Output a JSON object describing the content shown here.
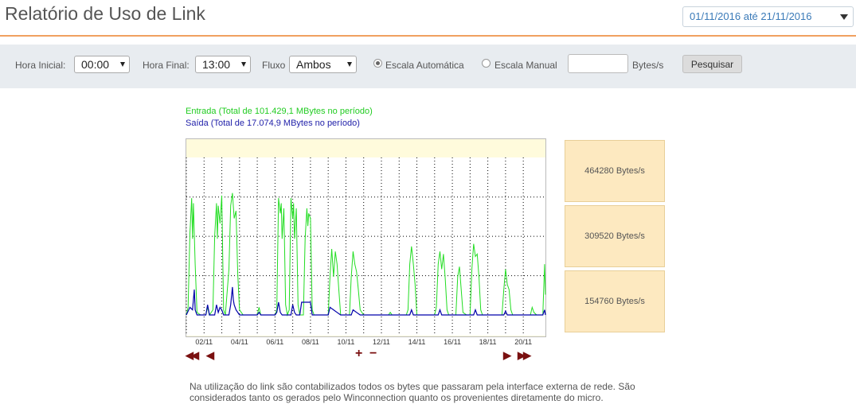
{
  "page": {
    "title": "Relatório de Uso de Link",
    "date_range": "01/11/2016 até 21/11/2016"
  },
  "filters": {
    "hora_inicial_label": "Hora Inicial:",
    "hora_inicial_value": "00:00",
    "hora_final_label": "Hora Final:",
    "hora_final_value": "13:00",
    "fluxo_label": "Fluxo",
    "fluxo_value": "Ambos",
    "escala_auto_label": "Escala Automática",
    "escala_auto_selected": true,
    "escala_manual_label": "Escala Manual",
    "bytes_value": "",
    "bytes_unit": "Bytes/s",
    "search_label": "Pesquisar"
  },
  "legend": {
    "entrada": "Entrada (Total de 101.429,1 MBytes no período)",
    "saida": "Saída (Total de 17.074,9 MBytes no período)"
  },
  "scale_labels": [
    "464280 Bytes/s",
    "309520 Bytes/s",
    "154760 Bytes/s"
  ],
  "nav": {
    "first": "◀◀",
    "prev": "◀",
    "zoom_in": "+",
    "zoom_out": "−",
    "next": "▶",
    "last": "▶▶"
  },
  "note": "Na utilização do link são contabilizados todos os bytes que passaram pela interface externa de rede. São considerados tanto os gerados pelo Winconnection quanto os provenientes diretamente do micro.",
  "chart_data": {
    "type": "line",
    "x_tick_labels": [
      "02/11",
      "04/11",
      "06/11",
      "08/11",
      "10/11",
      "12/11",
      "14/11",
      "16/11",
      "18/11",
      "20/11"
    ],
    "x_range_days": [
      1,
      21.25
    ],
    "ylim": [
      0,
      620000
    ],
    "y_gridlines": [
      154760,
      309520,
      464280
    ],
    "colors": {
      "entrada": "#22dd22",
      "saida": "#0000aa"
    },
    "series": [
      {
        "name": "Entrada",
        "points": [
          [
            1,
            0
          ],
          [
            1.1,
            30000
          ],
          [
            1.2,
            320000
          ],
          [
            1.3,
            460000
          ],
          [
            1.35,
            300000
          ],
          [
            1.4,
            440000
          ],
          [
            1.5,
            200000
          ],
          [
            1.6,
            10000
          ],
          [
            1.8,
            0
          ],
          [
            2.1,
            0
          ],
          [
            2.2,
            30000
          ],
          [
            2.3,
            0
          ],
          [
            2.5,
            20000
          ],
          [
            2.6,
            310000
          ],
          [
            2.7,
            440000
          ],
          [
            2.75,
            300000
          ],
          [
            2.8,
            430000
          ],
          [
            2.9,
            360000
          ],
          [
            3.0,
            470000
          ],
          [
            3.1,
            20000
          ],
          [
            3.2,
            0
          ],
          [
            3.4,
            180000
          ],
          [
            3.5,
            430000
          ],
          [
            3.6,
            480000
          ],
          [
            3.7,
            380000
          ],
          [
            3.8,
            410000
          ],
          [
            3.9,
            160000
          ],
          [
            4.0,
            20000
          ],
          [
            4.2,
            0
          ],
          [
            5.0,
            0
          ],
          [
            5.1,
            30000
          ],
          [
            5.2,
            0
          ],
          [
            6.0,
            0
          ],
          [
            6.1,
            20000
          ],
          [
            6.2,
            460000
          ],
          [
            6.3,
            400000
          ],
          [
            6.35,
            440000
          ],
          [
            6.4,
            300000
          ],
          [
            6.5,
            420000
          ],
          [
            6.6,
            40000
          ],
          [
            6.7,
            0
          ],
          [
            6.8,
            20000
          ],
          [
            6.9,
            460000
          ],
          [
            7.0,
            380000
          ],
          [
            7.05,
            440000
          ],
          [
            7.1,
            300000
          ],
          [
            7.2,
            420000
          ],
          [
            7.3,
            40000
          ],
          [
            7.4,
            0
          ],
          [
            7.6,
            0
          ],
          [
            7.7,
            300000
          ],
          [
            7.8,
            420000
          ],
          [
            7.85,
            350000
          ],
          [
            7.9,
            400000
          ],
          [
            8.0,
            380000
          ],
          [
            8.1,
            20000
          ],
          [
            8.2,
            0
          ],
          [
            9.0,
            0
          ],
          [
            9.1,
            150000
          ],
          [
            9.2,
            260000
          ],
          [
            9.3,
            150000
          ],
          [
            9.4,
            250000
          ],
          [
            9.5,
            200000
          ],
          [
            9.6,
            100000
          ],
          [
            9.7,
            0
          ],
          [
            10.2,
            0
          ],
          [
            10.3,
            150000
          ],
          [
            10.4,
            250000
          ],
          [
            10.5,
            200000
          ],
          [
            10.6,
            170000
          ],
          [
            10.7,
            100000
          ],
          [
            10.8,
            20000
          ],
          [
            11.0,
            0
          ],
          [
            12.4,
            0
          ],
          [
            12.5,
            10000
          ],
          [
            12.6,
            0
          ],
          [
            13.4,
            0
          ],
          [
            13.5,
            20000
          ],
          [
            13.6,
            200000
          ],
          [
            13.7,
            270000
          ],
          [
            13.8,
            200000
          ],
          [
            13.9,
            120000
          ],
          [
            14.0,
            0
          ],
          [
            15.0,
            0
          ],
          [
            15.1,
            30000
          ],
          [
            15.2,
            200000
          ],
          [
            15.3,
            250000
          ],
          [
            15.4,
            180000
          ],
          [
            15.5,
            240000
          ],
          [
            15.6,
            140000
          ],
          [
            15.7,
            20000
          ],
          [
            15.8,
            0
          ],
          [
            16.2,
            0
          ],
          [
            16.3,
            150000
          ],
          [
            16.4,
            190000
          ],
          [
            16.5,
            100000
          ],
          [
            16.6,
            10000
          ],
          [
            16.8,
            0
          ],
          [
            17.0,
            0
          ],
          [
            17.1,
            180000
          ],
          [
            17.2,
            280000
          ],
          [
            17.3,
            230000
          ],
          [
            17.4,
            240000
          ],
          [
            17.5,
            150000
          ],
          [
            17.6,
            20000
          ],
          [
            17.7,
            0
          ],
          [
            18.8,
            0
          ],
          [
            18.9,
            100000
          ],
          [
            19.0,
            180000
          ],
          [
            19.1,
            120000
          ],
          [
            19.2,
            100000
          ],
          [
            19.3,
            20000
          ],
          [
            19.4,
            0
          ],
          [
            20.4,
            0
          ],
          [
            20.5,
            30000
          ],
          [
            20.6,
            10000
          ],
          [
            20.75,
            0
          ],
          [
            21.1,
            0
          ],
          [
            21.2,
            200000
          ],
          [
            21.25,
            80000
          ]
        ]
      },
      {
        "name": "Saída",
        "points": [
          [
            1,
            0
          ],
          [
            1.2,
            30000
          ],
          [
            1.35,
            20000
          ],
          [
            1.45,
            100000
          ],
          [
            1.5,
            20000
          ],
          [
            1.6,
            0
          ],
          [
            2.1,
            0
          ],
          [
            2.2,
            40000
          ],
          [
            2.3,
            0
          ],
          [
            2.6,
            0
          ],
          [
            2.7,
            40000
          ],
          [
            2.8,
            10000
          ],
          [
            2.9,
            30000
          ],
          [
            3.0,
            20000
          ],
          [
            3.1,
            0
          ],
          [
            3.4,
            0
          ],
          [
            3.5,
            40000
          ],
          [
            3.6,
            110000
          ],
          [
            3.65,
            60000
          ],
          [
            3.7,
            40000
          ],
          [
            3.8,
            20000
          ],
          [
            4.0,
            0
          ],
          [
            4.2,
            0
          ],
          [
            5.0,
            0
          ],
          [
            5.1,
            10000
          ],
          [
            5.2,
            0
          ],
          [
            6.0,
            0
          ],
          [
            6.1,
            10000
          ],
          [
            6.2,
            50000
          ],
          [
            6.3,
            10000
          ],
          [
            6.4,
            0
          ],
          [
            6.9,
            0
          ],
          [
            7.0,
            40000
          ],
          [
            7.1,
            10000
          ],
          [
            7.2,
            0
          ],
          [
            7.4,
            0
          ],
          [
            7.5,
            50000
          ],
          [
            8.0,
            50000
          ],
          [
            8.1,
            0
          ],
          [
            9.0,
            0
          ],
          [
            9.1,
            30000
          ],
          [
            9.3,
            20000
          ],
          [
            9.5,
            10000
          ],
          [
            9.7,
            0
          ],
          [
            10.3,
            0
          ],
          [
            10.4,
            20000
          ],
          [
            10.6,
            10000
          ],
          [
            10.8,
            0
          ],
          [
            13.6,
            0
          ],
          [
            13.7,
            20000
          ],
          [
            13.8,
            0
          ],
          [
            15.2,
            0
          ],
          [
            15.3,
            20000
          ],
          [
            15.4,
            0
          ],
          [
            17.2,
            0
          ],
          [
            17.3,
            20000
          ],
          [
            17.4,
            0
          ],
          [
            18.9,
            0
          ],
          [
            19.0,
            15000
          ],
          [
            19.1,
            0
          ],
          [
            21.1,
            0
          ],
          [
            21.2,
            20000
          ],
          [
            21.25,
            0
          ]
        ]
      }
    ]
  }
}
